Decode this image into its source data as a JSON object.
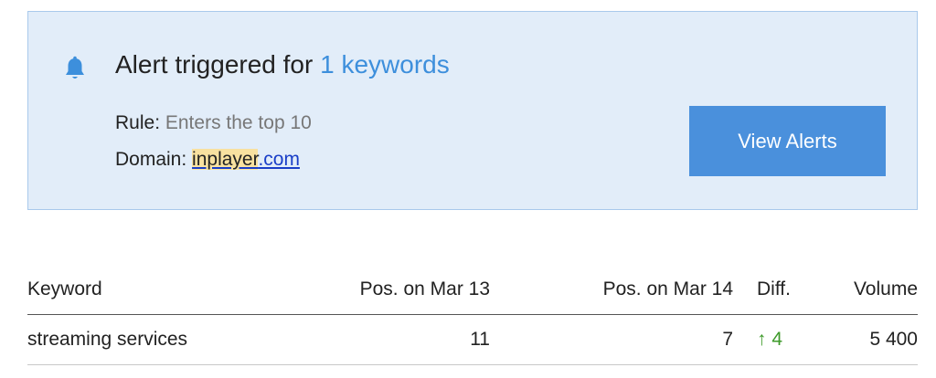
{
  "alert": {
    "title_prefix": "Alert triggered for ",
    "title_accent": "1 keywords",
    "rule_label": "Rule:",
    "rule_value": "Enters the top 10",
    "domain_label": "Domain:",
    "domain_highlight": "inplayer",
    "domain_suffix": ".com",
    "button_label": "View Alerts",
    "bell_icon": "bell-icon",
    "colors": {
      "background": "#e2edf9",
      "accent": "#3d8fdc",
      "button": "#4a90dc"
    }
  },
  "table": {
    "columns": [
      "Keyword",
      "Pos. on Mar 13",
      "Pos. on Mar 14",
      "Diff.",
      "Volume"
    ],
    "rows": [
      {
        "keyword": "streaming services",
        "pos_mar13": "11",
        "pos_mar14": "7",
        "diff_arrow": "↑",
        "diff_value": "4",
        "volume": "5 400"
      }
    ]
  }
}
